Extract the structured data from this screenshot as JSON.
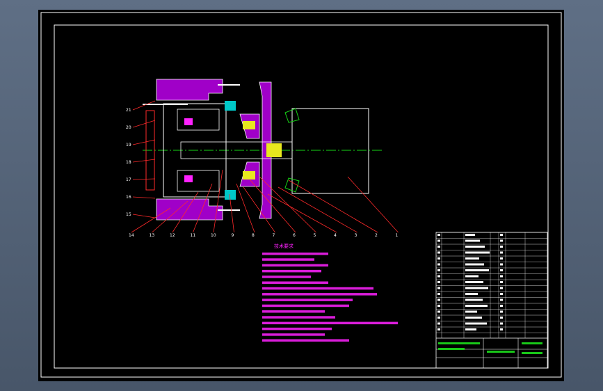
{
  "colors": {
    "background": "#000000",
    "frame": "#ffffff",
    "section_line": "#ff2a2a",
    "hatch": "#a000c8",
    "centerline": "#16d416",
    "notes_text": "#ff22ff",
    "table_line": "#ffffff",
    "table_text": "#ffffff",
    "table_green": "#19c819",
    "part_cyan": "#00c8c8",
    "part_yellow": "#e8e81e"
  },
  "drawing": {
    "part_numbers_bottom": [
      "14",
      "13",
      "12",
      "11",
      "10",
      "9",
      "8",
      "7",
      "6",
      "5",
      "4",
      "3",
      "2",
      "1"
    ],
    "part_numbers_left": [
      "21",
      "20",
      "19",
      "18",
      "17",
      "16",
      "15"
    ]
  },
  "notes": {
    "title": "技术要求"
  }
}
